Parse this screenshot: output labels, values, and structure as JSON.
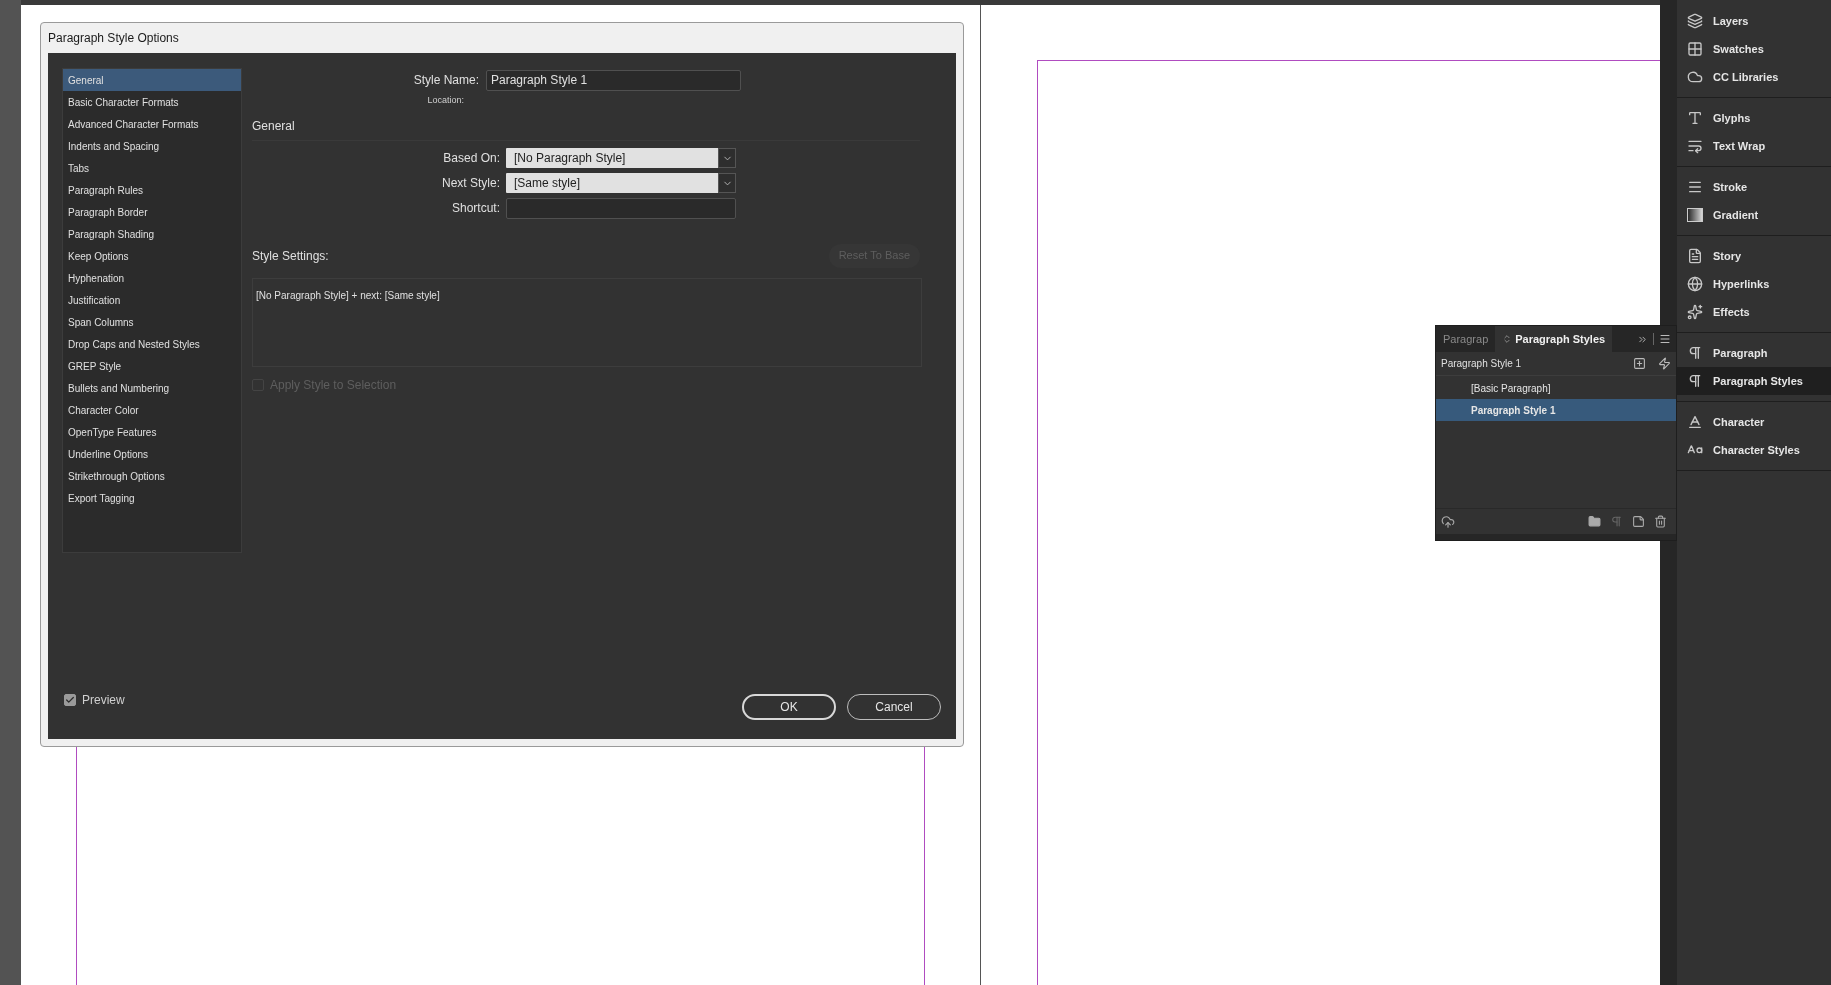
{
  "dialog": {
    "title": "Paragraph Style Options",
    "categories": [
      {
        "label": "General",
        "selected": true
      },
      {
        "label": "Basic Character Formats",
        "selected": false
      },
      {
        "label": "Advanced Character Formats",
        "selected": false
      },
      {
        "label": "Indents and Spacing",
        "selected": false
      },
      {
        "label": "Tabs",
        "selected": false
      },
      {
        "label": "Paragraph Rules",
        "selected": false
      },
      {
        "label": "Paragraph Border",
        "selected": false
      },
      {
        "label": "Paragraph Shading",
        "selected": false
      },
      {
        "label": "Keep Options",
        "selected": false
      },
      {
        "label": "Hyphenation",
        "selected": false
      },
      {
        "label": "Justification",
        "selected": false
      },
      {
        "label": "Span Columns",
        "selected": false
      },
      {
        "label": "Drop Caps and Nested Styles",
        "selected": false
      },
      {
        "label": "GREP Style",
        "selected": false
      },
      {
        "label": "Bullets and Numbering",
        "selected": false
      },
      {
        "label": "Character Color",
        "selected": false
      },
      {
        "label": "OpenType Features",
        "selected": false
      },
      {
        "label": "Underline Options",
        "selected": false
      },
      {
        "label": "Strikethrough Options",
        "selected": false
      },
      {
        "label": "Export Tagging",
        "selected": false
      }
    ],
    "style_name": {
      "label": "Style Name:",
      "value": "Paragraph Style 1"
    },
    "location_label": "Location:",
    "section_title": "General",
    "fields": [
      {
        "label": "Based On:",
        "kind": "dropdown",
        "value": "[No Paragraph Style]"
      },
      {
        "label": "Next Style:",
        "kind": "dropdown",
        "value": "[Same style]"
      },
      {
        "label": "Shortcut:",
        "kind": "text"
      }
    ],
    "style_settings": {
      "label": "Style Settings:",
      "text": "[No Paragraph Style] + next: [Same style]",
      "reset_button": {
        "label": "Reset To Base",
        "disabled": true
      }
    },
    "apply_checkbox": {
      "label": "Apply Style to Selection",
      "checked": false,
      "disabled": true
    },
    "preview": {
      "label": "Preview",
      "checked": true
    },
    "buttons": [
      {
        "label": "OK",
        "default": true
      },
      {
        "label": "Cancel",
        "default": false
      }
    ]
  },
  "styles_panel": {
    "tabs": [
      {
        "label": "Paragrap",
        "selected": false
      },
      {
        "label": "Paragraph Styles",
        "selected": true
      }
    ],
    "current_style": "Paragraph Style 1",
    "styles": [
      {
        "label": "[Basic Paragraph]",
        "selected": false
      },
      {
        "label": "Paragraph Style 1",
        "selected": true
      }
    ]
  },
  "dock": {
    "groups": [
      {
        "items": [
          {
            "label": "Layers",
            "selected": false
          },
          {
            "label": "Swatches",
            "selected": false
          },
          {
            "label": "CC Libraries",
            "selected": false
          }
        ]
      },
      {
        "items": [
          {
            "label": "Glyphs",
            "selected": false
          },
          {
            "label": "Text Wrap",
            "selected": false
          }
        ]
      },
      {
        "items": [
          {
            "label": "Stroke",
            "selected": false
          },
          {
            "label": "Gradient",
            "selected": false
          }
        ]
      },
      {
        "items": [
          {
            "label": "Story",
            "selected": false
          },
          {
            "label": "Hyperlinks",
            "selected": false
          },
          {
            "label": "Effects",
            "selected": false
          }
        ]
      },
      {
        "items": [
          {
            "label": "Paragraph",
            "selected": false
          },
          {
            "label": "Paragraph Styles",
            "selected": true
          }
        ]
      },
      {
        "items": [
          {
            "label": "Character",
            "selected": false
          },
          {
            "label": "Character Styles",
            "selected": false
          }
        ]
      }
    ]
  }
}
